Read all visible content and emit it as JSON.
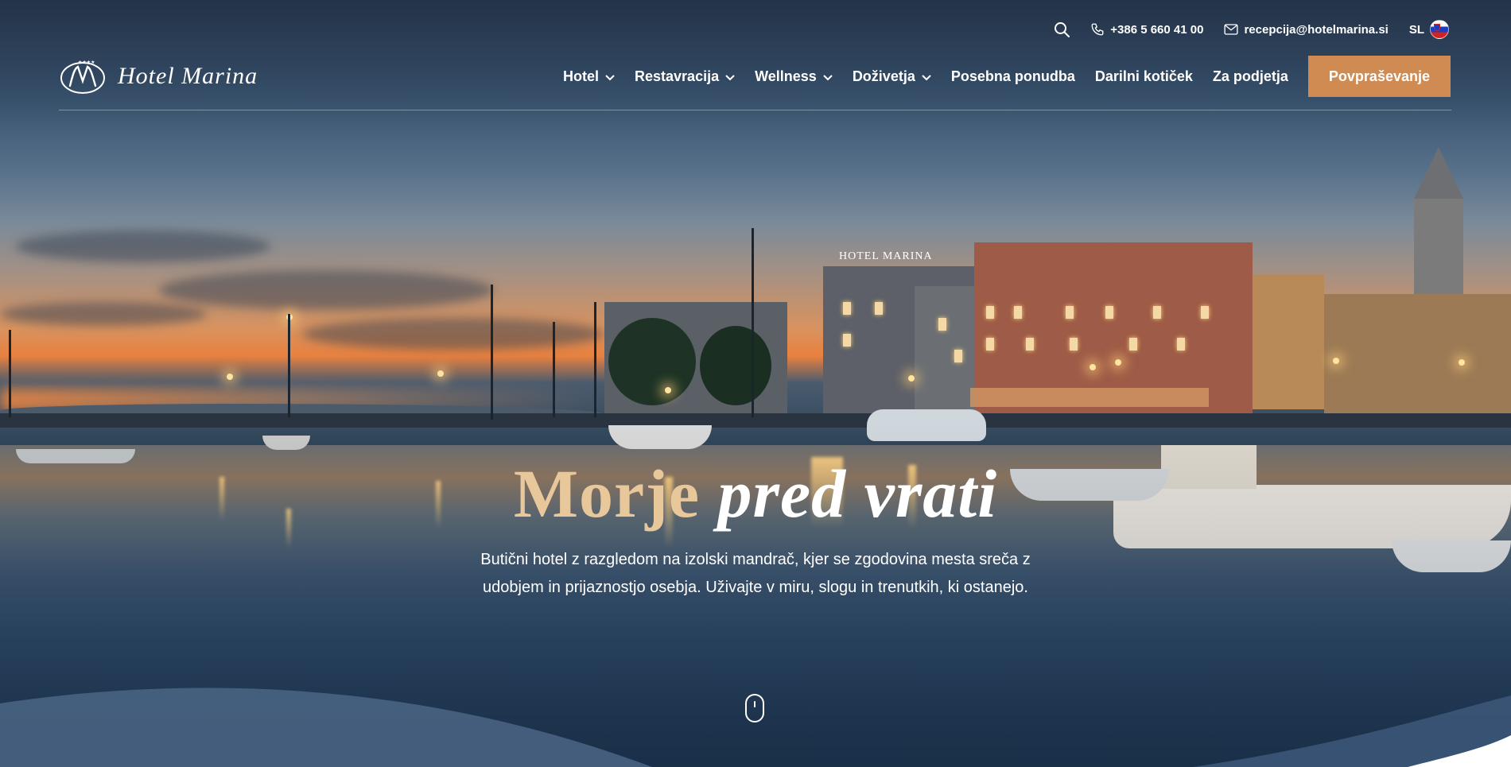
{
  "topbar": {
    "phone": "+386 5 660 41 00",
    "email": "recepcija@hotelmarina.si",
    "language": "SL"
  },
  "logo": {
    "text": "Hotel Marina"
  },
  "nav": {
    "items": [
      {
        "label": "Hotel",
        "dropdown": true
      },
      {
        "label": "Restavracija",
        "dropdown": true
      },
      {
        "label": "Wellness",
        "dropdown": true
      },
      {
        "label": "Doživetja",
        "dropdown": true
      },
      {
        "label": "Posebna ponudba",
        "dropdown": false
      },
      {
        "label": "Darilni kotiček",
        "dropdown": false
      },
      {
        "label": "Za podjetja",
        "dropdown": false
      }
    ],
    "cta_label": "Povpraševanje"
  },
  "hero": {
    "headline_part1": "Morje",
    "headline_part2": "pred vrati",
    "subtext_line1": "Butični hotel z razgledom na izolski mandrač, kjer se zgodovina mesta sreča z",
    "subtext_line2": "udobjem in prijaznostjo osebja. Uživajte v miru, slogu in trenutkih, ki ostanejo."
  },
  "icons": {
    "search": "search-icon",
    "phone": "phone-icon",
    "email": "mail-icon",
    "flag": "slovenia-flag-icon",
    "chevron": "chevron-down-icon",
    "scroll": "mouse-scroll-icon"
  },
  "colors": {
    "accent": "#d08b52",
    "headline_gold": "#e8c79a"
  }
}
